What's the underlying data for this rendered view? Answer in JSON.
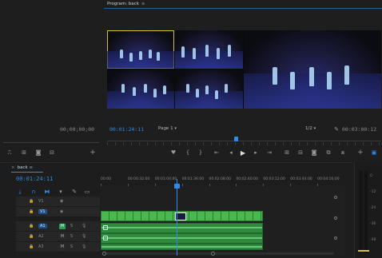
{
  "source_monitor": {
    "timecode": "00;00;00;00"
  },
  "program_monitor": {
    "tab_title": "Program: back",
    "tab_menu": "≡",
    "timecode_current": "00:01:24:11",
    "page_selector": "Page 1",
    "resolution": "1/2",
    "timecode_duration": "00:03:00:12",
    "progress": 0.47
  },
  "timeline": {
    "tab_close": "×",
    "sequence_name": "back",
    "tab_menu": "≡",
    "timecode": "00:01:24:11",
    "ruler_ticks": [
      "00:00",
      "00:00:32:00",
      "00:01:04:00",
      "00:01:36:00",
      "00:02:08:00",
      "00:02:40:00",
      "00:03:12:00",
      "00:03:44:00",
      "00:04:16:00"
    ],
    "tracks": [
      {
        "name": "V1",
        "type": "video"
      },
      {
        "name": "V1",
        "type": "video",
        "target": true
      },
      {
        "name": "A1",
        "type": "audio",
        "target": true,
        "m": "M",
        "s": "S"
      },
      {
        "name": "A2",
        "type": "audio",
        "m": "M",
        "s": "S"
      },
      {
        "name": "A3",
        "type": "audio",
        "m": "M",
        "s": "S"
      }
    ]
  },
  "audio_meter": {
    "ticks": [
      "0",
      "-12",
      "-24",
      "-36",
      "-48"
    ]
  },
  "colors": {
    "accent": "#2d8ceb",
    "video_clip": "#48b84f",
    "audio_clip": "#2f8a3e",
    "selection": "#d8c23a"
  }
}
